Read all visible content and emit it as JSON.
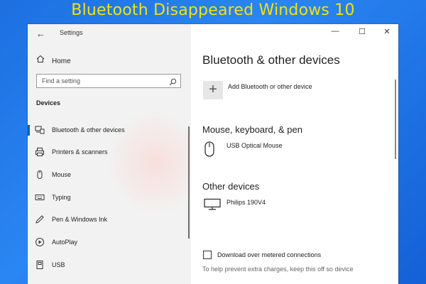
{
  "banner": {
    "text": "Bluetooth Disappeared Windows 10"
  },
  "window": {
    "title": "Settings",
    "controls": {
      "minimize": "—",
      "maximize": "☐",
      "close": "✕"
    },
    "back": "←"
  },
  "sidebar": {
    "home_label": "Home",
    "search_placeholder": "Find a setting",
    "section_label": "Devices",
    "items": [
      {
        "label": "Bluetooth & other devices",
        "icon": "bluetooth-devices-icon",
        "active": true
      },
      {
        "label": "Printers & scanners",
        "icon": "printer-icon",
        "active": false
      },
      {
        "label": "Mouse",
        "icon": "mouse-icon",
        "active": false
      },
      {
        "label": "Typing",
        "icon": "keyboard-icon",
        "active": false
      },
      {
        "label": "Pen & Windows Ink",
        "icon": "pen-icon",
        "active": false
      },
      {
        "label": "AutoPlay",
        "icon": "autoplay-icon",
        "active": false
      },
      {
        "label": "USB",
        "icon": "usb-icon",
        "active": false
      }
    ]
  },
  "main": {
    "title": "Bluetooth & other devices",
    "add_device_label": "Add Bluetooth or other device",
    "mouse_section": {
      "heading": "Mouse, keyboard, & pen",
      "device": "USB Optical Mouse"
    },
    "other_section": {
      "heading": "Other devices",
      "device": "Philips 190V4"
    },
    "metered": {
      "label": "Download over metered connections",
      "checked": false,
      "hint": "To help prevent extra charges, keep this off so device"
    }
  },
  "colors": {
    "background": "#1d6fe0",
    "banner_text": "#f5e20a",
    "accent": "#0063b1",
    "sidebar_bg": "#f2f2f2"
  }
}
